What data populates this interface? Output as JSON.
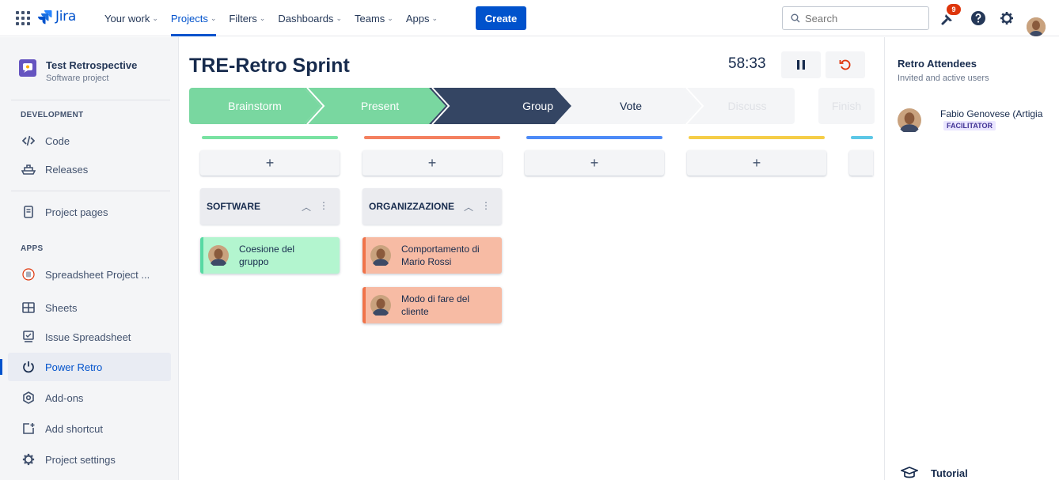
{
  "topbar": {
    "app_name": "Jira",
    "nav": [
      {
        "label": "Your work",
        "chev": "⌄"
      },
      {
        "label": "Projects",
        "chev": "⌄"
      },
      {
        "label": "Filters",
        "chev": "⌄"
      },
      {
        "label": "Dashboards",
        "chev": "⌄"
      },
      {
        "label": "Teams",
        "chev": "⌄"
      },
      {
        "label": "Apps",
        "chev": "⌄"
      }
    ],
    "create_label": "Create",
    "search_placeholder": "Search",
    "notification_count": "9",
    "accent": "#0052cc"
  },
  "sidebar": {
    "project_name": "Test Retrospective",
    "project_type": "Software project",
    "section_development": "DEVELOPMENT",
    "section_apps": "APPS",
    "items": [
      {
        "label": "Code",
        "icon": "code-icon"
      },
      {
        "label": "Releases",
        "icon": "ship-icon"
      },
      {
        "label": "Project pages",
        "icon": "document-icon"
      },
      {
        "label": "Spreadsheet Project ...",
        "icon": "spreadsheet-app-icon"
      },
      {
        "label": "Sheets",
        "icon": "grid-icon"
      },
      {
        "label": "Issue Spreadsheet",
        "icon": "monitor-icon"
      },
      {
        "label": "Power Retro",
        "icon": "power-icon"
      },
      {
        "label": "Add-ons",
        "icon": "addons-icon"
      },
      {
        "label": "Add shortcut",
        "icon": "add-shortcut-icon"
      },
      {
        "label": "Project settings",
        "icon": "gear-icon"
      }
    ]
  },
  "board": {
    "title": "TRE-Retro Sprint",
    "timer": "58:33",
    "steps": [
      {
        "label": "Brainstorm",
        "state": "done"
      },
      {
        "label": "Present",
        "state": "done"
      },
      {
        "label": "Group",
        "state": "current"
      },
      {
        "label": "Vote",
        "state": "next"
      },
      {
        "label": "Discuss",
        "state": "future"
      },
      {
        "label": "Finish",
        "state": "future"
      }
    ],
    "columns": [
      {
        "color": "#79e2a2",
        "add_label": "+",
        "group": "SOFTWARE",
        "cards": [
          {
            "text": "Coesione del gruppo",
            "bg": "#b3f5cf",
            "stripe": "#57d9a3"
          }
        ]
      },
      {
        "color": "#f4805f",
        "add_label": "+",
        "group": "ORGANIZZAZIONE",
        "cards": [
          {
            "text": "Comportamento di Mario Rossi",
            "bg": "#f7bba4",
            "stripe": "#f0734a"
          },
          {
            "text": "Modo di fare del cliente",
            "bg": "#f7bba4",
            "stripe": "#f0734a"
          }
        ]
      },
      {
        "color": "#4c8af7",
        "add_label": "+",
        "group": "",
        "cards": []
      },
      {
        "color": "#f5cd47",
        "add_label": "+",
        "group": "",
        "cards": []
      },
      {
        "color": "#5cc7e6",
        "add_label": "",
        "group": "",
        "cards": []
      }
    ]
  },
  "attendees": {
    "title": "Retro Attendees",
    "subtitle": "Invited and active users",
    "people": [
      {
        "name": "Fabio Genovese (Artigia",
        "role": "FACILITATOR"
      }
    ],
    "tutorial_label": "Tutorial"
  }
}
